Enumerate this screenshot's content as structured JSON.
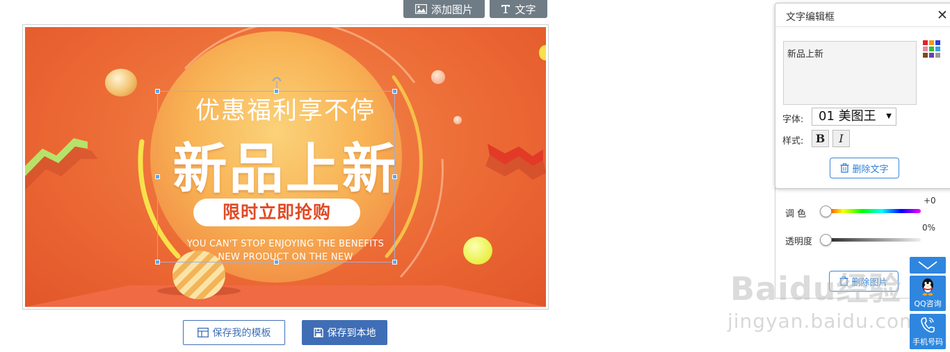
{
  "toolbar": {
    "add_image_label": "添加图片",
    "text_label": "文字"
  },
  "banner": {
    "line1": "优惠福利享不停",
    "headline": "新品上新",
    "pill": "限时立即抢购",
    "en_line1": "YOU CAN'T STOP ENJOYING THE BENEFITS",
    "en_line2": "NEW PRODUCT ON THE NEW"
  },
  "actions": {
    "save_template_label": "保存我的模板",
    "save_local_label": "保存到本地"
  },
  "text_editor": {
    "title": "文字编辑框",
    "text_value": "新品上新",
    "font_label": "字体:",
    "font_value": "01 美图王",
    "style_label": "样式:",
    "bold_label": "B",
    "italic_label": "I",
    "delete_text_label": "删除文字",
    "palette_colors": [
      "#e02424",
      "#f59a1c",
      "#2b3fd6",
      "#e98aa2",
      "#2fbf3a",
      "#3aa0e8",
      "#7a4a1a",
      "#6a3fb5",
      "#999999"
    ]
  },
  "adjust": {
    "hue_label": "调  色",
    "hue_value": "+0",
    "hue_level": 0,
    "opacity_label": "透明度",
    "opacity_value": "0%",
    "opacity_level": 0,
    "obscured_button_label": "删除图片"
  },
  "float": {
    "qq_label": "QQ咨询",
    "phone_label": "手机号码"
  },
  "watermark": {
    "logo": "Baidu经验",
    "url": "jingyan.baidu.com"
  },
  "colors": {
    "toolbar_bg": "#6f7c86",
    "primary": "#3f6eb6",
    "float_blue": "#2e86df",
    "banner_orange": "#ec6a35"
  }
}
